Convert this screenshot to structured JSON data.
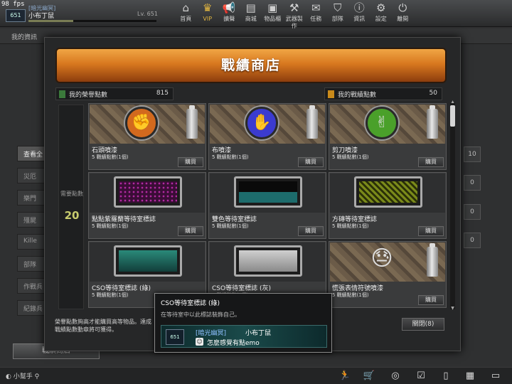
{
  "fps": "98 fps",
  "player": {
    "rank": "651",
    "clan": "[暗光幽冥]",
    "nick": "小布丁鼠",
    "level": "Lv. 651"
  },
  "nav": [
    {
      "label": "首頁",
      "icon": "home-icon",
      "glyph": "⌂"
    },
    {
      "label": "VIP",
      "icon": "crown-icon",
      "glyph": "♛"
    },
    {
      "label": "擴聲",
      "icon": "megaphone-icon",
      "glyph": "📢"
    },
    {
      "label": "商城",
      "icon": "store-icon",
      "glyph": "▤"
    },
    {
      "label": "物品櫃",
      "icon": "inventory-icon",
      "glyph": "▣"
    },
    {
      "label": "武器製作",
      "icon": "weapon-craft-icon",
      "glyph": "⚒"
    },
    {
      "label": "任務",
      "icon": "mission-icon",
      "glyph": "✉"
    },
    {
      "label": "部隊",
      "icon": "clan-icon",
      "glyph": "⛉"
    },
    {
      "label": "資訊",
      "icon": "info-icon",
      "glyph": "ⓘ"
    },
    {
      "label": "設定",
      "icon": "settings-icon",
      "glyph": "⚙"
    },
    {
      "label": "離開",
      "icon": "exit-icon",
      "glyph": "⏻"
    }
  ],
  "background": {
    "tab": "我的資訊",
    "menu": [
      "查看全",
      "災厄",
      "樂門",
      "殭屍",
      "Kille",
      "部隊",
      "作戰兵",
      "紀錄兵"
    ],
    "shop_button": "戰績商店",
    "right_nums": [
      "10",
      "0",
      "0",
      "0"
    ]
  },
  "shop": {
    "title": "戰績商店",
    "honor_label": "我的榮譽點數",
    "honor_value": "815",
    "battle_label": "我的戰績點數",
    "battle_value": "50",
    "side_label": "需要點數",
    "side_value": "20",
    "buy_label": "購買",
    "items": [
      {
        "name": "石頭噴漆",
        "price": "5 戰績點數(1個)",
        "art": "rock-spray",
        "glyph": "✊",
        "color": "#d2691e"
      },
      {
        "name": "布噴漆",
        "price": "5 戰績點數(1個)",
        "art": "paper-spray",
        "glyph": "✋",
        "color": "#3b3bd0"
      },
      {
        "name": "剪刀噴漆",
        "price": "5 戰績點數(1個)",
        "art": "scissors-spray",
        "glyph": "✌",
        "color": "#4aa02a"
      },
      {
        "name": "點點紫羅蘭等待室標誌",
        "price": "5 戰績點數(1個)",
        "art": "plate",
        "pattern": "radial-gradient(circle, #b02aa0 30%, #3a0d36 32%) 0 0/6px 6px"
      },
      {
        "name": "雙色等待室標誌",
        "price": "5 戰績點數(1個)",
        "art": "plate",
        "pattern": "linear-gradient(#0a0a0a 50%, #1d6c6c 50%)"
      },
      {
        "name": "方磚等待室標誌",
        "price": "5 戰績點數(1個)",
        "art": "plate",
        "pattern": "repeating-linear-gradient(45deg, #7a8a1a 0 3px, #2a2f08 3px 6px)"
      },
      {
        "name": "CSO等待室標誌 (綠)",
        "price": "5 戰績點數(1個)",
        "art": "plate",
        "pattern": "linear-gradient(#2a8a7a, #123e3a)"
      },
      {
        "name": "CSO等待室標誌 (灰)",
        "price": "5 戰績點數(1個)",
        "art": "plate",
        "pattern": "linear-gradient(#cfcfcf, #8a8a8a)"
      },
      {
        "name": "慌張表情符號噴漆",
        "price": "5 戰績點數(1個)",
        "art": "stone-emoji",
        "glyph": "😓",
        "color": "#f0d020"
      }
    ],
    "note": "榮譽點數夠高才能購買高等物品。達成戰績點數動章將可獲得。",
    "close_label": "關閉(8)"
  },
  "tooltip": {
    "title": "CSO等待室標誌 (綠)",
    "desc": "在等待室中以此標誌裝飾自己。",
    "badge": "651",
    "clan": "[暗光幽冥]",
    "nick": "小布丁鼠",
    "msg": "怎麼感覺有點emo"
  },
  "bottom": {
    "helper": "小幫手"
  }
}
